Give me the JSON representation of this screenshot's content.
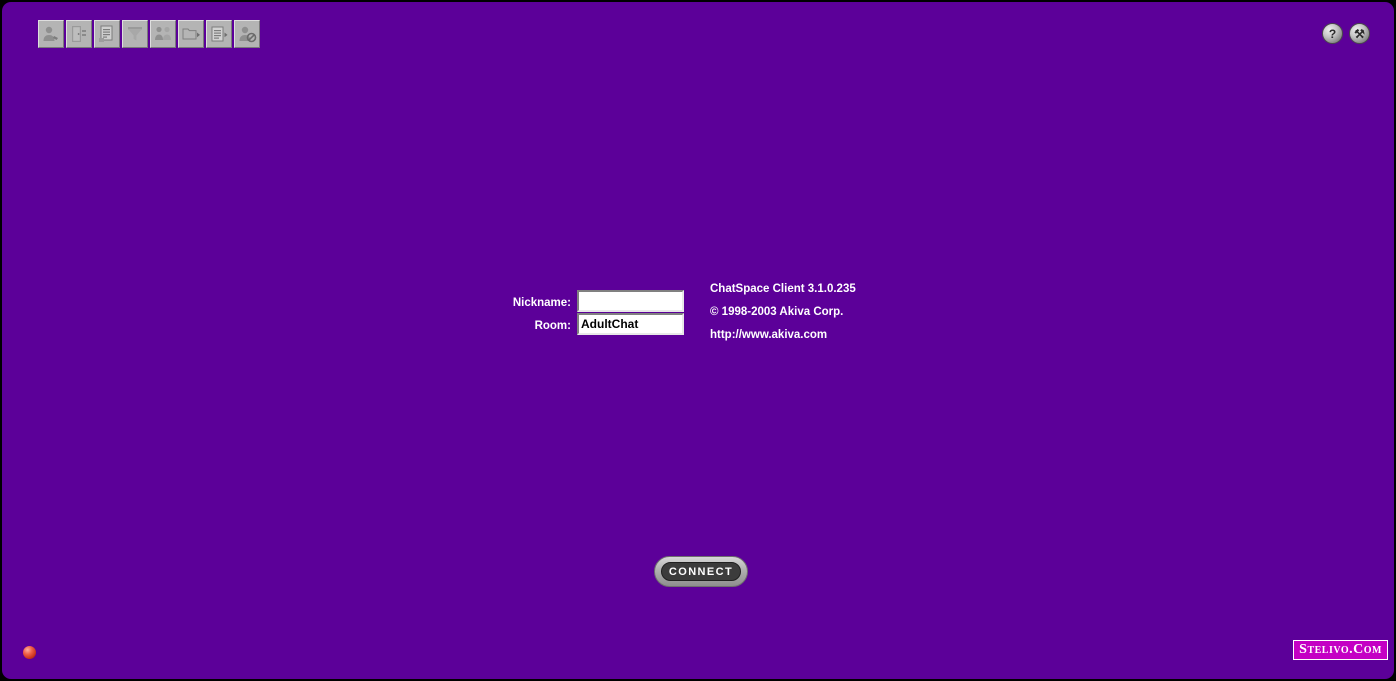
{
  "window": {
    "title": "ChatSpace Client",
    "background_color": "#5c0099",
    "border_color": "#000000"
  },
  "toolbar": {
    "buttons": [
      {
        "name": "user-profile-icon",
        "tooltip": "User Profile"
      },
      {
        "name": "door-exit-icon",
        "tooltip": "Enter / Leave Room"
      },
      {
        "name": "document-list-icon",
        "tooltip": "Room List"
      },
      {
        "name": "filter-funnel-icon",
        "tooltip": "Filter"
      },
      {
        "name": "two-people-icon",
        "tooltip": "Members"
      },
      {
        "name": "folder-arrow-icon",
        "tooltip": "Open Folder"
      },
      {
        "name": "notepad-arrow-icon",
        "tooltip": "Open Log"
      },
      {
        "name": "user-block-icon",
        "tooltip": "Ignore User"
      }
    ]
  },
  "top_right": {
    "help_label": "?",
    "tools_label": "⚒",
    "buttons": [
      {
        "name": "help-button",
        "tooltip": "Help"
      },
      {
        "name": "tools-button",
        "tooltip": "Tools"
      }
    ]
  },
  "login": {
    "nickname_label": "Nickname:",
    "nickname_value": "",
    "nickname_placeholder": "",
    "room_label": "Room:",
    "room_value": "AdultChat",
    "room_placeholder": ""
  },
  "about": {
    "product_line": "ChatSpace Client 3.1.0.235",
    "copyright_line": "© 1998-2003 Akiva Corp.",
    "url_line": "http://www.akiva.com"
  },
  "connect": {
    "label": "CONNECT"
  },
  "status": {
    "indicator_color": "#d8381f",
    "indicator_name": "connection-status-light"
  },
  "branding": {
    "logo_text": "Stelivo.Com",
    "logo_background": "#c400c4",
    "logo_text_color": "#ffffff"
  }
}
